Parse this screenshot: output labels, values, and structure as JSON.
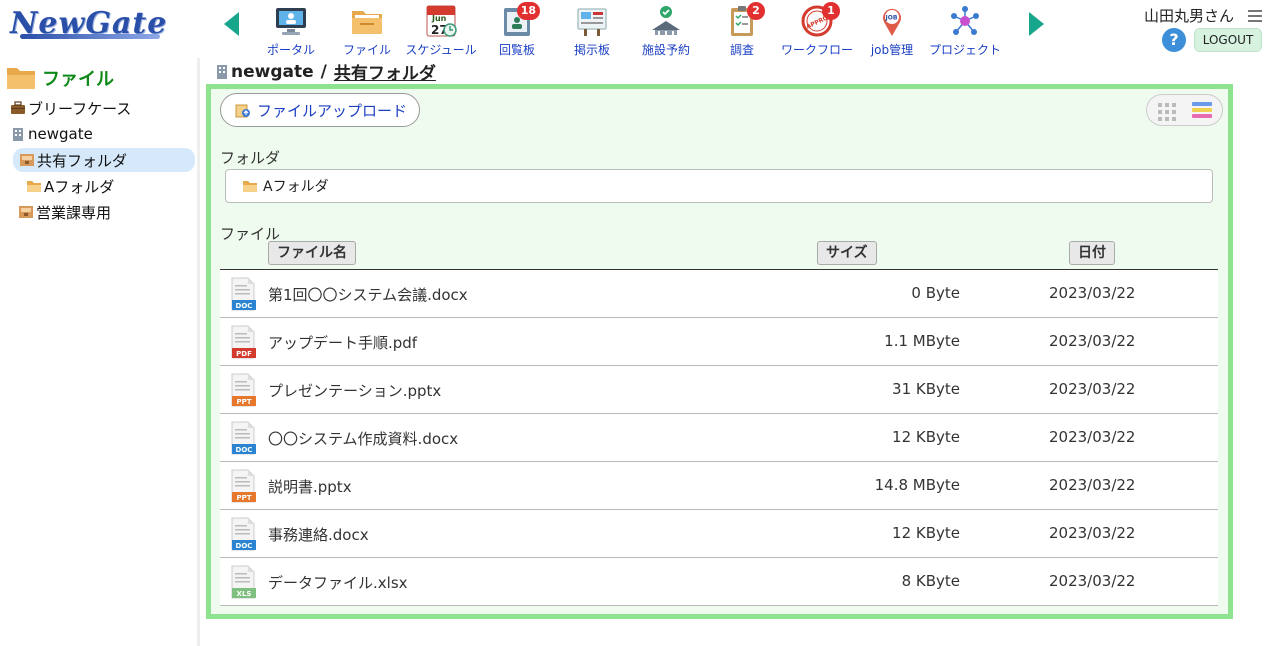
{
  "brand": {
    "logo_text": "NewGate"
  },
  "colors": {
    "accent": "#17a58c",
    "link": "#1a3fc4",
    "panel_border": "#8fe38f",
    "panel_bg": "#f0fbf0",
    "badge": "#e23030",
    "sidebar_title": "#0f8a1a"
  },
  "apps": [
    {
      "label": "ポータル",
      "icon": "portal-icon",
      "badge": null
    },
    {
      "label": "ファイル",
      "icon": "file-folder-icon",
      "badge": null
    },
    {
      "label": "スケジュール",
      "icon": "calendar-icon",
      "badge": null,
      "cal_month": "Jun",
      "cal_day": "27"
    },
    {
      "label": "回覧板",
      "icon": "circular-board-icon",
      "badge": "18"
    },
    {
      "label": "掲示板",
      "icon": "bulletin-board-icon",
      "badge": null
    },
    {
      "label": "施設予約",
      "icon": "facility-reservation-icon",
      "badge": null
    },
    {
      "label": "調査",
      "icon": "survey-clipboard-icon",
      "badge": "2"
    },
    {
      "label": "ワークフロー",
      "icon": "approved-stamp-icon",
      "badge": "1",
      "stamp_text": "APPROVED"
    },
    {
      "label": "job管理",
      "icon": "job-pin-icon",
      "badge": null,
      "pin_text": "JOB"
    },
    {
      "label": "プロジェクト",
      "icon": "project-network-icon",
      "badge": null
    }
  ],
  "user": {
    "name": "山田丸男さん",
    "logout_label": "LOGOUT",
    "help_label": "?"
  },
  "sidebar": {
    "title": "ファイル",
    "items": [
      {
        "label": "ブリーフケース",
        "icon": "briefcase-icon"
      },
      {
        "label": "newgate",
        "icon": "building-icon"
      },
      {
        "label": "共有フォルダ",
        "icon": "shared-folder-icon"
      },
      {
        "label": "Aフォルダ",
        "icon": "folder-icon"
      },
      {
        "label": "営業課専用",
        "icon": "shared-folder-icon"
      }
    ]
  },
  "breadcrumb": {
    "root": "newgate",
    "sep": "/",
    "current": "共有フォルダ"
  },
  "toolbar": {
    "upload_label": "ファイルアップロード"
  },
  "folders_section": {
    "label": "フォルダ",
    "folders": [
      {
        "name": "Aフォルダ"
      }
    ]
  },
  "files_section": {
    "label": "ファイル",
    "columns": {
      "name": "ファイル名",
      "size": "サイズ",
      "date": "日付"
    },
    "files": [
      {
        "name": "第1回〇〇システム会議.docx",
        "size": "0 Byte",
        "date": "2023/03/22",
        "type": "DOC",
        "color": "#2a84d2"
      },
      {
        "name": "アップデート手順.pdf",
        "size": "1.1 MByte",
        "date": "2023/03/22",
        "type": "PDF",
        "color": "#d33b2f"
      },
      {
        "name": "プレゼンテーション.pptx",
        "size": "31 KByte",
        "date": "2023/03/22",
        "type": "PPT",
        "color": "#e8772e"
      },
      {
        "name": "〇〇システム作成資料.docx",
        "size": "12 KByte",
        "date": "2023/03/22",
        "type": "DOC",
        "color": "#2a84d2"
      },
      {
        "name": "説明書.pptx",
        "size": "14.8 MByte",
        "date": "2023/03/22",
        "type": "PPT",
        "color": "#e8772e"
      },
      {
        "name": "事務連絡.docx",
        "size": "12 KByte",
        "date": "2023/03/22",
        "type": "DOC",
        "color": "#2a84d2"
      },
      {
        "name": "データファイル.xlsx",
        "size": "8 KByte",
        "date": "2023/03/22",
        "type": "XLS",
        "color": "#7fbf7f"
      }
    ]
  }
}
